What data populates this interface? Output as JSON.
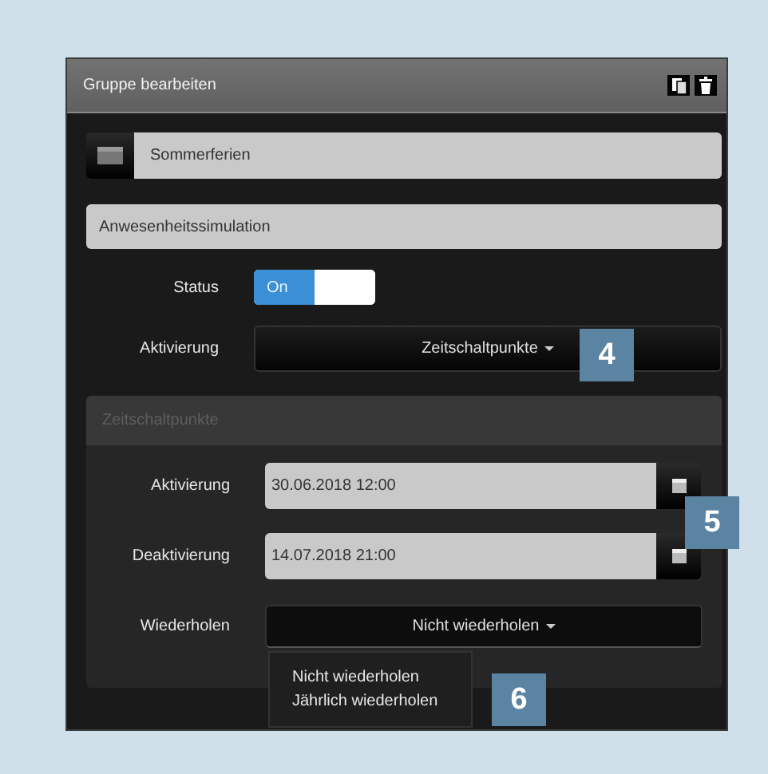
{
  "window": {
    "title": "Gruppe bearbeiten"
  },
  "name_field": {
    "value": "Sommerferien"
  },
  "type_field": {
    "value": "Anwesenheitssimulation"
  },
  "status": {
    "label": "Status",
    "on_label": "On",
    "on": true
  },
  "activation": {
    "label": "Aktivierung",
    "value": "Zeitschaltpunkte"
  },
  "schedule": {
    "title": "Zeitschaltpunkte",
    "dates": [
      {
        "label": "Aktivierung",
        "value": "30.06.2018 12:00"
      },
      {
        "label": "Deaktivierung",
        "value": "14.07.2018 21:00"
      }
    ],
    "repeat": {
      "label": "Wiederholen",
      "value": "Nicht wiederholen",
      "expanded": true,
      "options": [
        {
          "label": "Nicht wiederholen"
        },
        {
          "label": "Jährlich wiederholen"
        }
      ]
    }
  },
  "callouts": [
    "4",
    "5",
    "6"
  ]
}
